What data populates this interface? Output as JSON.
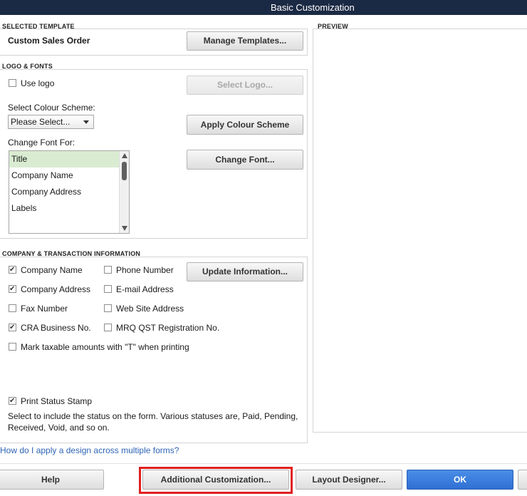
{
  "window": {
    "title": "Basic Customization"
  },
  "selected_template": {
    "section_label": "SELECTED TEMPLATE",
    "name": "Custom Sales Order",
    "manage_button": "Manage Templates..."
  },
  "logo_fonts": {
    "section_label": "LOGO & FONTS",
    "use_logo": {
      "label": "Use logo",
      "checked": false
    },
    "select_logo_button": "Select Logo...",
    "colour_scheme_label": "Select Colour Scheme:",
    "colour_scheme_value": "Please Select...",
    "apply_colour_button": "Apply Colour Scheme",
    "change_font_label": "Change Font For:",
    "font_items": [
      "Title",
      "Company Name",
      "Company Address",
      "Labels"
    ],
    "selected_font_item": "Title",
    "change_font_button": "Change Font..."
  },
  "company_info": {
    "section_label": "COMPANY & TRANSACTION INFORMATION",
    "options": [
      {
        "label": "Company Name",
        "checked": true
      },
      {
        "label": "Phone Number",
        "checked": false
      },
      {
        "label": "Company Address",
        "checked": true
      },
      {
        "label": "E-mail Address",
        "checked": false
      },
      {
        "label": "Fax Number",
        "checked": false
      },
      {
        "label": "Web Site Address",
        "checked": false
      },
      {
        "label": "CRA Business No.",
        "checked": true
      },
      {
        "label": "MRQ QST Registration No.",
        "checked": false
      },
      {
        "label": "Mark taxable amounts with \"T\" when printing",
        "checked": false
      },
      {
        "label": "Print Status Stamp",
        "checked": true
      }
    ],
    "update_button": "Update Information...",
    "status_note": "Select to include the status on the form. Various statuses are, Paid, Pending, Received, Void, and so on."
  },
  "preview": {
    "section_label": "PREVIEW"
  },
  "help_link": "How do I apply a design across multiple forms?",
  "footer": {
    "help": "Help",
    "additional": "Additional Customization...",
    "layout_designer": "Layout Designer...",
    "ok": "OK"
  },
  "colors": {
    "titlebar": "#1b2a44",
    "ok_button": "#2f6fd2",
    "highlight": "#e02020",
    "selected_item": "#d9ecd1",
    "link": "#2f64b5"
  }
}
